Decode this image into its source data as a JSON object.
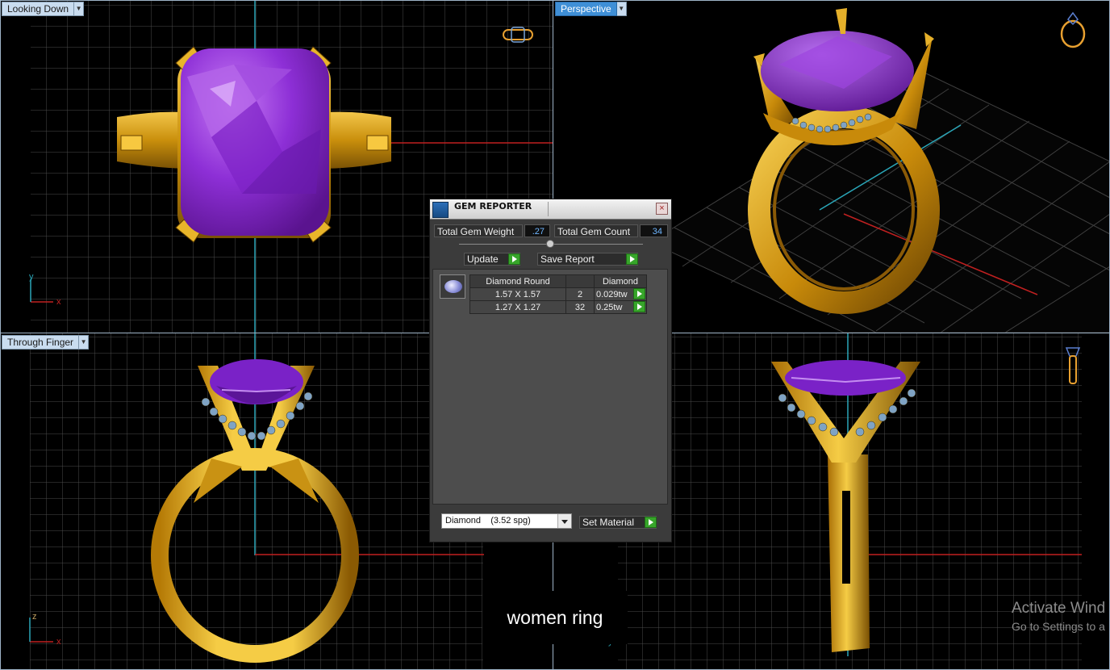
{
  "viewports": {
    "top_left": {
      "label": "Looking Down"
    },
    "top_right": {
      "label": "Perspective"
    },
    "bottom_left": {
      "label": "Through Finger"
    },
    "bottom_right": {
      "label": ""
    }
  },
  "axes": {
    "x": "x",
    "y": "y",
    "z": "z"
  },
  "gem_reporter": {
    "title": "GEM REPORTER",
    "close_glyph": "×",
    "total_weight_label": "Total Gem Weight",
    "total_weight_value": ".27",
    "total_count_label": "Total Gem Count",
    "total_count_value": "34",
    "update_label": "Update",
    "save_report_label": "Save Report",
    "table": {
      "headers": [
        "Diamond Round",
        "",
        "Diamond"
      ],
      "rows": [
        {
          "size": "1.57 X 1.57",
          "count": "2",
          "weight": "0.029tw"
        },
        {
          "size": "1.27 X 1.27",
          "count": "32",
          "weight": "0.25tw"
        }
      ]
    },
    "material_select": "Diamond    (3.52 spg)",
    "set_material_label": "Set Material"
  },
  "caption": "women ring",
  "watermark": {
    "line1": "Activate Wind",
    "line2": "Go to Settings to a"
  },
  "colors": {
    "gold": "#d9a316",
    "amethyst": "#8a2be2",
    "grid": "#5a5a5a",
    "accent_blue": "#3f8fd6"
  }
}
